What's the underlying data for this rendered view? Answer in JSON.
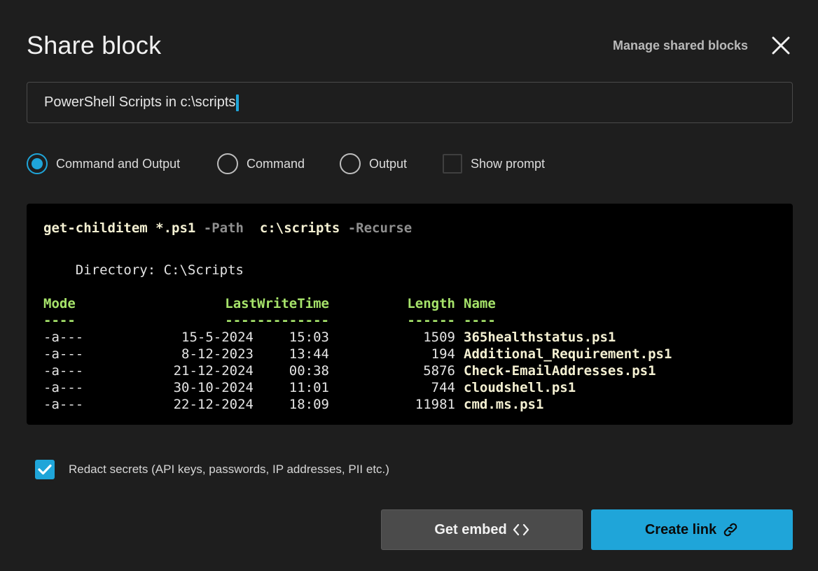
{
  "dialog": {
    "title": "Share block",
    "manage_link": "Manage shared blocks"
  },
  "title_input": {
    "value": "PowerShell Scripts in c:\\scripts"
  },
  "options": [
    {
      "label": "Command and Output",
      "checked": true
    },
    {
      "label": "Command",
      "checked": false
    },
    {
      "label": "Output",
      "checked": false
    },
    {
      "label": "Show prompt",
      "checked": false
    }
  ],
  "terminal": {
    "command": "get-childitem",
    "arg1": " *.ps1 ",
    "flag1": "-Path",
    "arg2": "  c:\\scripts ",
    "flag2": "-Recurse",
    "directory_line": "    Directory: C:\\Scripts",
    "headers": {
      "mode": "Mode",
      "lastwritetime": "LastWriteTime",
      "length": "Length",
      "name": "Name"
    },
    "separators": {
      "mode": "----",
      "lastwritetime": "-------------",
      "length": "------",
      "name": "----"
    },
    "rows": [
      {
        "mode": "-a---",
        "date": "15-5-2024",
        "time": "15:03",
        "length": "1509",
        "name": "365healthstatus.ps1"
      },
      {
        "mode": "-a---",
        "date": "8-12-2023",
        "time": "13:44",
        "length": "194",
        "name": "Additional_Requirement.ps1"
      },
      {
        "mode": "-a---",
        "date": "21-12-2024",
        "time": "00:38",
        "length": "5876",
        "name": "Check-EmailAddresses.ps1"
      },
      {
        "mode": "-a---",
        "date": "30-10-2024",
        "time": "11:01",
        "length": "744",
        "name": "cloudshell.ps1"
      },
      {
        "mode": "-a---",
        "date": "22-12-2024",
        "time": "18:09",
        "length": "11981",
        "name": "cmd.ms.ps1"
      }
    ]
  },
  "redact": {
    "label": "Redact secrets (API keys, passwords, IP addresses, PII etc.)",
    "checked": true
  },
  "buttons": {
    "embed_label": "Get embed",
    "create_link_label": "Create link"
  },
  "colors": {
    "accent": "#1fa5d9",
    "background": "#1e1e1e",
    "terminal_bg": "#000000",
    "header_green": "#a6e36a",
    "bold_yellow": "#f4f0d2"
  },
  "icons": {
    "close": "close-icon",
    "caret": "text-caret",
    "check": "checkmark-icon",
    "embed": "code-brackets-icon",
    "link": "link-icon"
  }
}
